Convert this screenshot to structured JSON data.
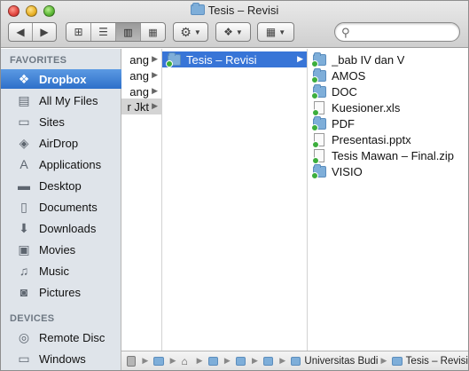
{
  "window": {
    "title": "Tesis – Revisi"
  },
  "toolbar": {
    "back_icon": "back-arrow-icon",
    "forward_icon": "forward-arrow-icon",
    "view_icons": [
      "icon-view-icon",
      "list-view-icon",
      "column-view-icon",
      "coverflow-view-icon"
    ],
    "active_view": "column-view",
    "action_icon": "gear-icon",
    "dropbox_icon": "dropbox-icon",
    "arrange_icon": "arrange-grid-icon",
    "search": {
      "value": "",
      "placeholder": ""
    }
  },
  "sidebar": {
    "favorites_header": "FAVORITES",
    "favorites": [
      {
        "label": "Dropbox",
        "icon": "dropbox-icon",
        "selected": true
      },
      {
        "label": "All My Files",
        "icon": "all-files-icon"
      },
      {
        "label": "Sites",
        "icon": "folder-icon"
      },
      {
        "label": "AirDrop",
        "icon": "airdrop-icon"
      },
      {
        "label": "Applications",
        "icon": "applications-icon"
      },
      {
        "label": "Desktop",
        "icon": "desktop-icon"
      },
      {
        "label": "Documents",
        "icon": "documents-icon"
      },
      {
        "label": "Downloads",
        "icon": "downloads-icon"
      },
      {
        "label": "Movies",
        "icon": "movies-icon"
      },
      {
        "label": "Music",
        "icon": "music-icon"
      },
      {
        "label": "Pictures",
        "icon": "pictures-icon"
      }
    ],
    "devices_header": "DEVICES",
    "devices": [
      {
        "label": "Remote Disc",
        "icon": "remote-disc-icon"
      },
      {
        "label": "Windows",
        "icon": "hard-disk-icon"
      }
    ]
  },
  "columns": {
    "col1": [
      "ang",
      "ang",
      "ang",
      "r Jkt"
    ],
    "col2": [
      {
        "label": "Tesis – Revisi",
        "type": "folder",
        "synced": true,
        "selected": true
      }
    ],
    "col3": [
      {
        "label": "_bab IV dan V",
        "type": "folder",
        "synced": true
      },
      {
        "label": "AMOS",
        "type": "folder",
        "synced": true
      },
      {
        "label": "DOC",
        "type": "folder",
        "synced": true
      },
      {
        "label": "Kuesioner.xls",
        "type": "doc",
        "synced": true
      },
      {
        "label": "PDF",
        "type": "folder",
        "synced": true
      },
      {
        "label": "Presentasi.pptx",
        "type": "doc",
        "synced": true
      },
      {
        "label": "Tesis Mawan – Final.zip",
        "type": "doc",
        "synced": true
      },
      {
        "label": "VISIO",
        "type": "folder",
        "synced": true
      }
    ]
  },
  "pathbar": {
    "items": [
      "Universitas Budi",
      "Tesis – Revisi"
    ]
  },
  "colors": {
    "selection_blue": "#3875d7",
    "sidebar_bg": "#dfe4ea",
    "folder_blue": "#7eaed9",
    "sync_green": "#3cae3c"
  }
}
